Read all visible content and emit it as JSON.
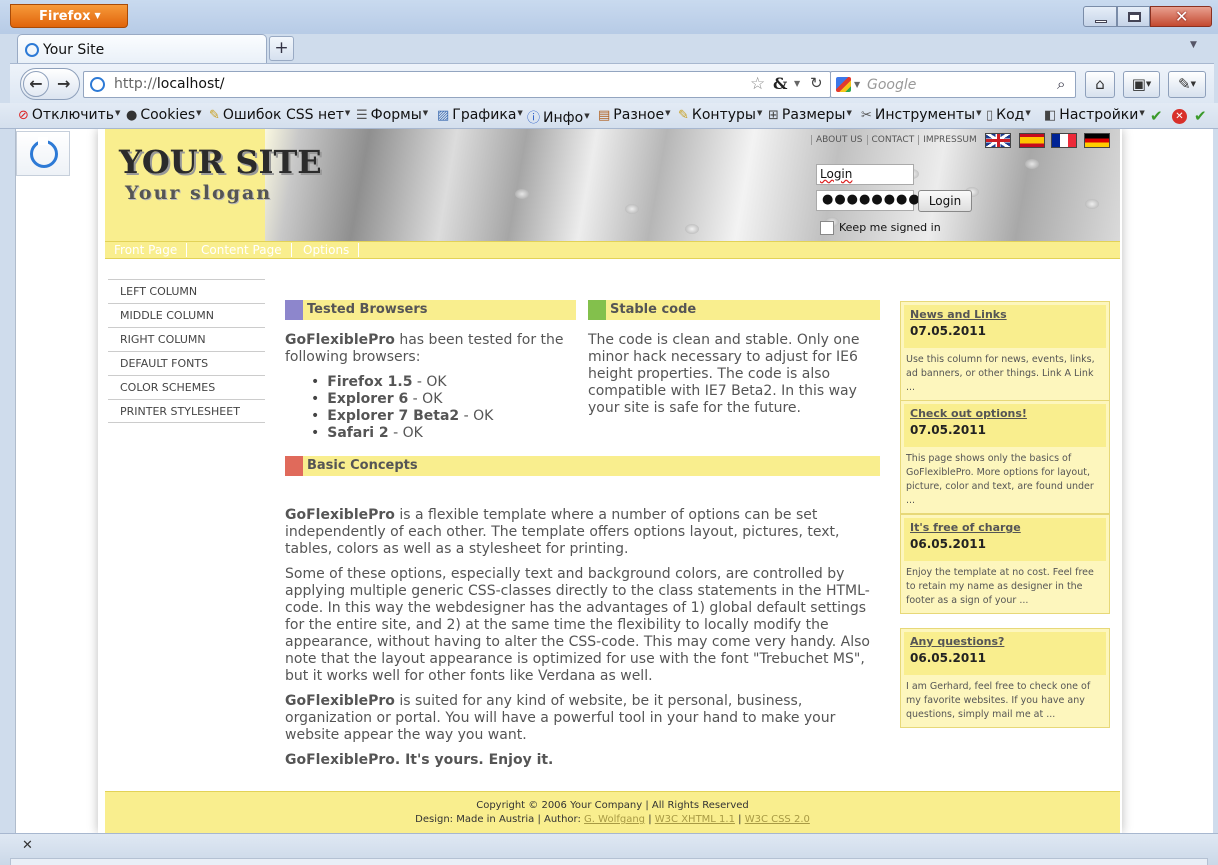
{
  "browser": {
    "app_button": "Firefox",
    "tab_title": "Your Site",
    "url_prefix": "http://",
    "url_host": "localhost/",
    "search_placeholder": "Google"
  },
  "toolbar": {
    "items": [
      {
        "label": "Отключить",
        "icon": "no-icon"
      },
      {
        "label": "Cookies",
        "icon": "user-icon"
      },
      {
        "label": "Ошибок CSS нет",
        "icon": "pencil-icon"
      },
      {
        "label": "Формы",
        "icon": "form-icon"
      },
      {
        "label": "Графика",
        "icon": "image-icon"
      },
      {
        "label": "Инфо",
        "icon": "info-icon"
      },
      {
        "label": "Разное",
        "icon": "misc-icon"
      },
      {
        "label": "Контуры",
        "icon": "outline-icon"
      },
      {
        "label": "Размеры",
        "icon": "resize-icon"
      },
      {
        "label": "Инструменты",
        "icon": "tools-icon"
      },
      {
        "label": "Код",
        "icon": "source-icon"
      },
      {
        "label": "Настройки",
        "icon": "settings-icon"
      }
    ]
  },
  "site": {
    "title": "YOUR SITE",
    "slogan": "Your slogan",
    "toplinks": [
      "ABOUT US",
      "CONTACT",
      "IMPRESSUM"
    ],
    "login": {
      "username_value": "Login",
      "password_value": "●●●●●●●●",
      "button": "Login",
      "keep_label": "Keep me signed in"
    },
    "mainnav": [
      "Front Page",
      "Content Page",
      "Options"
    ],
    "leftnav": [
      "LEFT COLUMN",
      "MIDDLE COLUMN",
      "RIGHT COLUMN",
      "DEFAULT FONTS",
      "COLOR SCHEMES",
      "PRINTER STYLESHEET"
    ]
  },
  "content": {
    "tested": {
      "heading": "Tested Browsers",
      "intro_strong": "GoFlexiblePro",
      "intro_rest": " has been tested for the following browsers:",
      "browsers": [
        {
          "name": "Firefox 1.5",
          "status": " - OK"
        },
        {
          "name": "Explorer 6",
          "status": " - OK"
        },
        {
          "name": "Explorer 7 Beta2",
          "status": " - OK"
        },
        {
          "name": "Safari 2",
          "status": " - OK"
        }
      ]
    },
    "stable": {
      "heading": "Stable code",
      "text": "The code is clean and stable. Only one minor hack necessary to adjust for IE6 height properties. The code is also compatible with IE7 Beta2. In this way your site is safe for the future."
    },
    "concepts": {
      "heading": "Basic Concepts",
      "p1_strong": "GoFlexiblePro",
      "p1_rest": " is a flexible template where a number of options can be set independently of each other. The template offers options layout, pictures, text, tables, colors as well as a stylesheet for printing.",
      "p2": "Some of these options, especially text and background colors, are controlled by applying multiple generic CSS-classes directly to the class statements in the HTML-code. In this way the webdesigner has the advantages of 1) global default settings for the entire site, and 2) at the same time the flexibility to locally modify the appearance, without having to alter the CSS-code. This may come very handy. Also note that the layout appearance is optimized for use with the font \"Trebuchet MS\", but it works well for other fonts like Verdana as well.",
      "p3_strong": "GoFlexiblePro",
      "p3_rest": " is suited for any kind of website, be it personal, business, organization or portal. You will have a powerful tool in your hand to make your website appear the way you want.",
      "p4": "GoFlexiblePro. It's yours. Enjoy it."
    }
  },
  "news": [
    {
      "title": "News and Links",
      "date": "07.05.2011",
      "text": "Use this column for news, events, links, ad banners, or other things. Link A Link ..."
    },
    {
      "title": "Check out options!",
      "date": "07.05.2011",
      "text": "This page shows only the basics of GoFlexiblePro. More options for layout, picture, color and text, are found under ..."
    },
    {
      "title": "It's free of charge",
      "date": "06.05.2011",
      "text": "Enjoy the template at no cost. Feel free to retain my name as designer in the footer as a sign of your ..."
    },
    {
      "title": "Any questions?",
      "date": "06.05.2011",
      "text": "I am Gerhard, feel free to check one of my favorite websites. If you have any questions, simply mail me at ..."
    }
  ],
  "footer": {
    "line1": "Copyright © 2006 Your Company | All Rights Reserved",
    "design_prefix": "Design: Made in Austria | Author: ",
    "author": "G. Wolfgang",
    "xhtml": "W3C XHTML 1.1",
    "css": "W3C CSS 2.0"
  },
  "colors": {
    "accent_yellow": "#f9ee8e",
    "tested_square": "#8d86cc",
    "stable_square": "#83c04c",
    "concepts_square": "#e06a5b"
  }
}
